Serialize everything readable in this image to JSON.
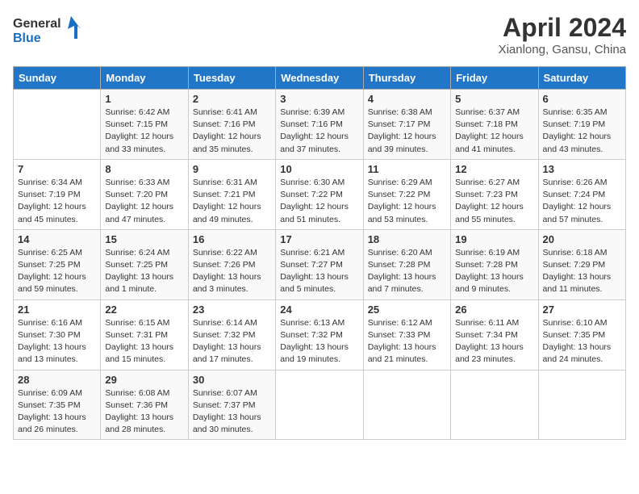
{
  "logo": {
    "line1": "General",
    "line2": "Blue"
  },
  "title": "April 2024",
  "subtitle": "Xianlong, Gansu, China",
  "days_of_week": [
    "Sunday",
    "Monday",
    "Tuesday",
    "Wednesday",
    "Thursday",
    "Friday",
    "Saturday"
  ],
  "weeks": [
    [
      {
        "day": "",
        "sunrise": "",
        "sunset": "",
        "daylight": ""
      },
      {
        "day": "1",
        "sunrise": "Sunrise: 6:42 AM",
        "sunset": "Sunset: 7:15 PM",
        "daylight": "Daylight: 12 hours and 33 minutes."
      },
      {
        "day": "2",
        "sunrise": "Sunrise: 6:41 AM",
        "sunset": "Sunset: 7:16 PM",
        "daylight": "Daylight: 12 hours and 35 minutes."
      },
      {
        "day": "3",
        "sunrise": "Sunrise: 6:39 AM",
        "sunset": "Sunset: 7:16 PM",
        "daylight": "Daylight: 12 hours and 37 minutes."
      },
      {
        "day": "4",
        "sunrise": "Sunrise: 6:38 AM",
        "sunset": "Sunset: 7:17 PM",
        "daylight": "Daylight: 12 hours and 39 minutes."
      },
      {
        "day": "5",
        "sunrise": "Sunrise: 6:37 AM",
        "sunset": "Sunset: 7:18 PM",
        "daylight": "Daylight: 12 hours and 41 minutes."
      },
      {
        "day": "6",
        "sunrise": "Sunrise: 6:35 AM",
        "sunset": "Sunset: 7:19 PM",
        "daylight": "Daylight: 12 hours and 43 minutes."
      }
    ],
    [
      {
        "day": "7",
        "sunrise": "Sunrise: 6:34 AM",
        "sunset": "Sunset: 7:19 PM",
        "daylight": "Daylight: 12 hours and 45 minutes."
      },
      {
        "day": "8",
        "sunrise": "Sunrise: 6:33 AM",
        "sunset": "Sunset: 7:20 PM",
        "daylight": "Daylight: 12 hours and 47 minutes."
      },
      {
        "day": "9",
        "sunrise": "Sunrise: 6:31 AM",
        "sunset": "Sunset: 7:21 PM",
        "daylight": "Daylight: 12 hours and 49 minutes."
      },
      {
        "day": "10",
        "sunrise": "Sunrise: 6:30 AM",
        "sunset": "Sunset: 7:22 PM",
        "daylight": "Daylight: 12 hours and 51 minutes."
      },
      {
        "day": "11",
        "sunrise": "Sunrise: 6:29 AM",
        "sunset": "Sunset: 7:22 PM",
        "daylight": "Daylight: 12 hours and 53 minutes."
      },
      {
        "day": "12",
        "sunrise": "Sunrise: 6:27 AM",
        "sunset": "Sunset: 7:23 PM",
        "daylight": "Daylight: 12 hours and 55 minutes."
      },
      {
        "day": "13",
        "sunrise": "Sunrise: 6:26 AM",
        "sunset": "Sunset: 7:24 PM",
        "daylight": "Daylight: 12 hours and 57 minutes."
      }
    ],
    [
      {
        "day": "14",
        "sunrise": "Sunrise: 6:25 AM",
        "sunset": "Sunset: 7:25 PM",
        "daylight": "Daylight: 12 hours and 59 minutes."
      },
      {
        "day": "15",
        "sunrise": "Sunrise: 6:24 AM",
        "sunset": "Sunset: 7:25 PM",
        "daylight": "Daylight: 13 hours and 1 minute."
      },
      {
        "day": "16",
        "sunrise": "Sunrise: 6:22 AM",
        "sunset": "Sunset: 7:26 PM",
        "daylight": "Daylight: 13 hours and 3 minutes."
      },
      {
        "day": "17",
        "sunrise": "Sunrise: 6:21 AM",
        "sunset": "Sunset: 7:27 PM",
        "daylight": "Daylight: 13 hours and 5 minutes."
      },
      {
        "day": "18",
        "sunrise": "Sunrise: 6:20 AM",
        "sunset": "Sunset: 7:28 PM",
        "daylight": "Daylight: 13 hours and 7 minutes."
      },
      {
        "day": "19",
        "sunrise": "Sunrise: 6:19 AM",
        "sunset": "Sunset: 7:28 PM",
        "daylight": "Daylight: 13 hours and 9 minutes."
      },
      {
        "day": "20",
        "sunrise": "Sunrise: 6:18 AM",
        "sunset": "Sunset: 7:29 PM",
        "daylight": "Daylight: 13 hours and 11 minutes."
      }
    ],
    [
      {
        "day": "21",
        "sunrise": "Sunrise: 6:16 AM",
        "sunset": "Sunset: 7:30 PM",
        "daylight": "Daylight: 13 hours and 13 minutes."
      },
      {
        "day": "22",
        "sunrise": "Sunrise: 6:15 AM",
        "sunset": "Sunset: 7:31 PM",
        "daylight": "Daylight: 13 hours and 15 minutes."
      },
      {
        "day": "23",
        "sunrise": "Sunrise: 6:14 AM",
        "sunset": "Sunset: 7:32 PM",
        "daylight": "Daylight: 13 hours and 17 minutes."
      },
      {
        "day": "24",
        "sunrise": "Sunrise: 6:13 AM",
        "sunset": "Sunset: 7:32 PM",
        "daylight": "Daylight: 13 hours and 19 minutes."
      },
      {
        "day": "25",
        "sunrise": "Sunrise: 6:12 AM",
        "sunset": "Sunset: 7:33 PM",
        "daylight": "Daylight: 13 hours and 21 minutes."
      },
      {
        "day": "26",
        "sunrise": "Sunrise: 6:11 AM",
        "sunset": "Sunset: 7:34 PM",
        "daylight": "Daylight: 13 hours and 23 minutes."
      },
      {
        "day": "27",
        "sunrise": "Sunrise: 6:10 AM",
        "sunset": "Sunset: 7:35 PM",
        "daylight": "Daylight: 13 hours and 24 minutes."
      }
    ],
    [
      {
        "day": "28",
        "sunrise": "Sunrise: 6:09 AM",
        "sunset": "Sunset: 7:35 PM",
        "daylight": "Daylight: 13 hours and 26 minutes."
      },
      {
        "day": "29",
        "sunrise": "Sunrise: 6:08 AM",
        "sunset": "Sunset: 7:36 PM",
        "daylight": "Daylight: 13 hours and 28 minutes."
      },
      {
        "day": "30",
        "sunrise": "Sunrise: 6:07 AM",
        "sunset": "Sunset: 7:37 PM",
        "daylight": "Daylight: 13 hours and 30 minutes."
      },
      {
        "day": "",
        "sunrise": "",
        "sunset": "",
        "daylight": ""
      },
      {
        "day": "",
        "sunrise": "",
        "sunset": "",
        "daylight": ""
      },
      {
        "day": "",
        "sunrise": "",
        "sunset": "",
        "daylight": ""
      },
      {
        "day": "",
        "sunrise": "",
        "sunset": "",
        "daylight": ""
      }
    ]
  ]
}
